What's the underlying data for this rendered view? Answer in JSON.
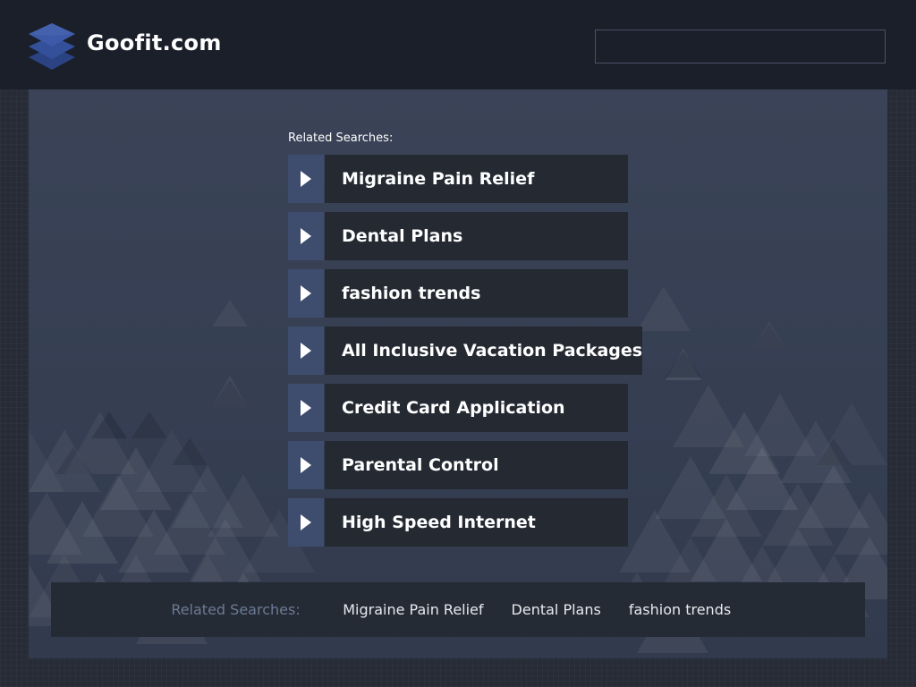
{
  "header": {
    "logo_icon": "stacked-layers-icon",
    "site_name": "Goofit.com",
    "search": {
      "value": "",
      "placeholder": ""
    }
  },
  "related": {
    "heading": "Related Searches:",
    "links": [
      {
        "label": "Migraine Pain Relief"
      },
      {
        "label": "Dental Plans"
      },
      {
        "label": "fashion trends"
      },
      {
        "label": "All Inclusive Vacation Packages"
      },
      {
        "label": "Credit Card Application"
      },
      {
        "label": "Parental Control"
      },
      {
        "label": "High Speed Internet"
      }
    ],
    "arrow_icon": "play-arrow-icon"
  },
  "footer": {
    "heading": "Related Searches:",
    "links": [
      {
        "label": "Migraine Pain Relief"
      },
      {
        "label": "Dental Plans"
      },
      {
        "label": "fashion trends"
      }
    ]
  },
  "colors": {
    "page_bg": "#262b35",
    "header_bg": "#1a1f2a",
    "panel_bg": "#3a4357",
    "link_bg": "#242932",
    "arrow_bg": "#3e4c6e",
    "logo_blue": "#3d5aa8",
    "footer_heading": "#6b7a94"
  }
}
